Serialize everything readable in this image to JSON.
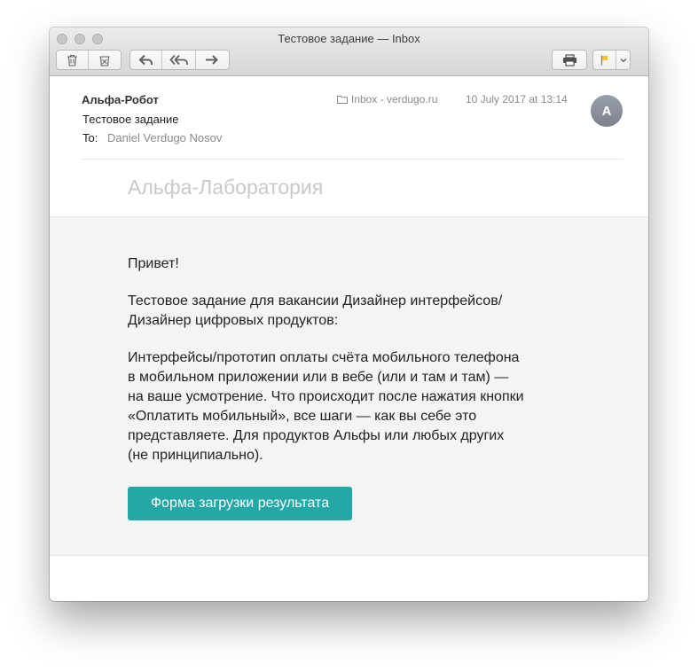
{
  "window": {
    "title": "Тестовое задание — Inbox"
  },
  "toolbar": {
    "icons": [
      "trash-icon",
      "junk-icon",
      "reply-icon",
      "reply-all-icon",
      "forward-icon",
      "print-icon",
      "flag-icon",
      "chevron-down-icon"
    ],
    "flag_color": "#f0c419"
  },
  "message": {
    "sender": "Альфа-Робот",
    "subject": "Тестовое задание",
    "to_label": "To:",
    "to_value": "Daniel Verdugo Nosov",
    "mailbox": "Inbox - verdugo.ru",
    "date": "10 July 2017 at 13:14",
    "avatar_initial": "A"
  },
  "content": {
    "brand": "Альфа-Лаборатория",
    "paragraphs": [
      [
        "Привет!"
      ],
      [
        "Тестовое задание для вакансии Дизайнер интерфейсов/",
        "Дизайнер цифровых продуктов:"
      ],
      [
        "Интерфейсы/прототип оплаты счёта мобильного телефона",
        "в мобильном приложении или в вебе (или и там и там) —",
        "на ваше усмотрение. Что происходит после нажатия кнопки",
        "«Оплатить мобильный», все шаги — как вы себе это",
        "представляете. Для продуктов Альфы или любых других",
        "(не принципиально)."
      ]
    ],
    "button_label": "Форма загрузки результата",
    "button_color": "#23a8a5"
  }
}
